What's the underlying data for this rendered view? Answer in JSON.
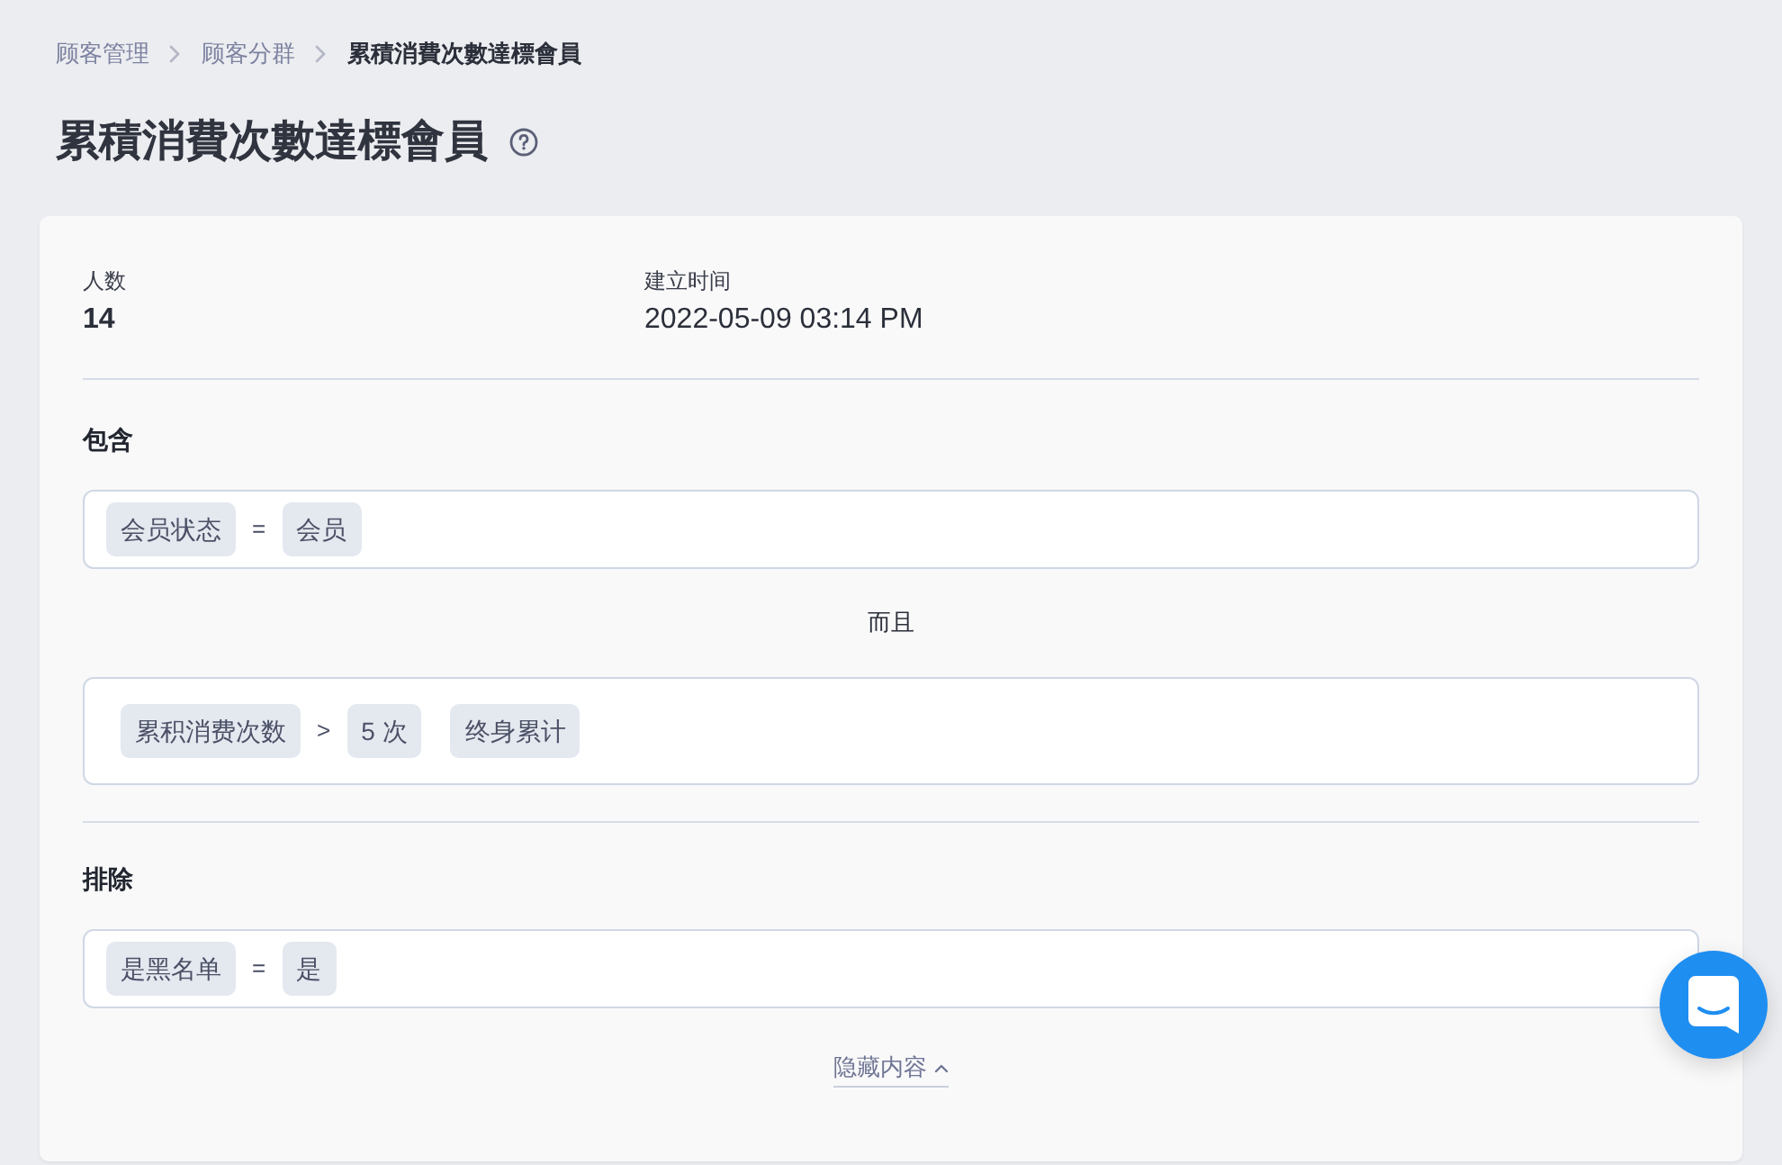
{
  "breadcrumb": [
    {
      "label": "顾客管理",
      "current": false
    },
    {
      "label": "顾客分群",
      "current": false
    },
    {
      "label": "累積消費次數達標會員",
      "current": true
    }
  ],
  "page_title": "累積消費次數達標會員",
  "stats": [
    {
      "kind": "count",
      "label": "人数",
      "value": "14"
    },
    {
      "kind": "date",
      "label": "建立时间",
      "value": "2022-05-09 03:14 PM"
    }
  ],
  "include": {
    "heading": "包含",
    "items": [
      {
        "kind": "condition",
        "tokens": [
          {
            "kind": "chip",
            "text": "会员状态"
          },
          {
            "kind": "operator",
            "text": "="
          },
          {
            "kind": "chip",
            "text": "会员"
          }
        ]
      },
      {
        "kind": "joiner",
        "text": "而且"
      },
      {
        "kind": "group",
        "tokens": [
          {
            "kind": "chip",
            "text": "累积消费次数"
          },
          {
            "kind": "operator",
            "text": ">"
          },
          {
            "kind": "chip",
            "text": "5 次"
          },
          {
            "kind": "qualifier",
            "text": "终身累计"
          }
        ]
      }
    ]
  },
  "exclude": {
    "heading": "排除",
    "items": [
      {
        "kind": "condition",
        "tokens": [
          {
            "kind": "chip",
            "text": "是黑名单"
          },
          {
            "kind": "operator",
            "text": "="
          },
          {
            "kind": "chip",
            "text": "是"
          }
        ]
      }
    ]
  },
  "toggle": {
    "label": "隐藏内容",
    "expanded": true
  }
}
